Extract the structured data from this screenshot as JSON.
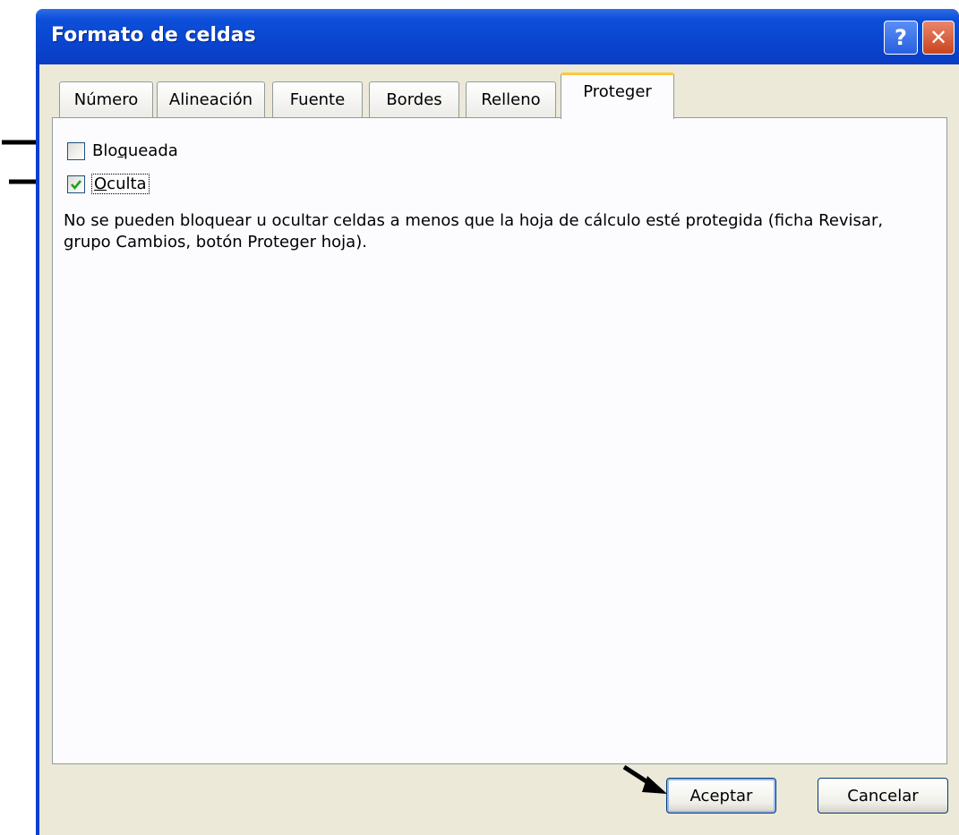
{
  "window": {
    "title": "Formato de celdas",
    "help_glyph": "?",
    "close_glyph": "✕"
  },
  "tabs": [
    {
      "label": "Número",
      "active": false
    },
    {
      "label": "Alineación",
      "active": false
    },
    {
      "label": "Fuente",
      "active": false
    },
    {
      "label": "Bordes",
      "active": false
    },
    {
      "label": "Relleno",
      "active": false
    },
    {
      "label": "Proteger",
      "active": true
    }
  ],
  "protect": {
    "locked": {
      "label_pre": "Blo",
      "label_accel": "q",
      "label_post": "ueada",
      "checked": false
    },
    "hidden": {
      "label_pre": "",
      "label_accel": "O",
      "label_post": "culta",
      "checked": true
    },
    "description": "No se pueden bloquear u ocultar celdas a menos que la hoja de cálculo esté protegida (ficha Revisar, grupo Cambios, botón Proteger hoja)."
  },
  "buttons": {
    "ok": "Aceptar",
    "cancel": "Cancelar"
  },
  "colors": {
    "titlebar": "#0a45cf",
    "active_tab_accent": "#ffc83c",
    "check_mark": "#21a121"
  }
}
